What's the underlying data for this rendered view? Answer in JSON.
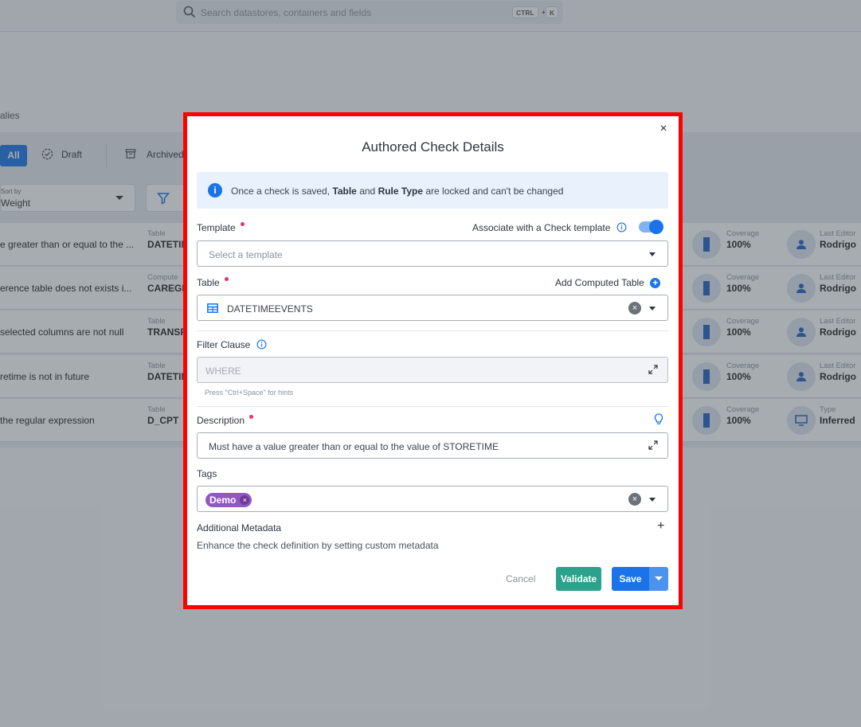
{
  "app": {
    "search_placeholder": "Search datastores, containers and fields",
    "kbd_ctrl": "CTRL",
    "kbd_plus": "+",
    "kbd_k": "K",
    "breadcrumb": "alies",
    "tabs": {
      "all": "All",
      "draft": "Draft",
      "archived": "Archived"
    },
    "sort": {
      "label": "Sort by",
      "value": "Weight"
    },
    "rows": [
      {
        "name": "e greater than or equal to the ...",
        "table_label": "Table",
        "table": "DATETIM",
        "metric_label": "Coverage",
        "metric": "100%",
        "editor_label": "Last Editor",
        "editor": "Rodrigo"
      },
      {
        "name": "erence table does not exists i...",
        "table_label": "Compute",
        "table": "CAREGIV",
        "metric_label": "Coverage",
        "metric": "100%",
        "editor_label": "Last Editor",
        "editor": "Rodrigo"
      },
      {
        "name": "selected columns are not null",
        "table_label": "Table",
        "table": "TRANSF",
        "metric_label": "Coverage",
        "metric": "100%",
        "editor_label": "Last Editor",
        "editor": "Rodrigo"
      },
      {
        "name": "retime is not in future",
        "table_label": "Table",
        "table": "DATETIM",
        "metric_label": "Coverage",
        "metric": "100%",
        "editor_label": "Last Editor",
        "editor": "Rodrigo"
      },
      {
        "name": "the regular expression",
        "table_label": "Table",
        "table": "D_CPT",
        "metric_label": "Coverage",
        "metric": "100%",
        "editor_label": "Type",
        "editor": "Inferred"
      }
    ]
  },
  "modal": {
    "title": "Authored Check Details",
    "info": {
      "prefix": "Once a check is saved, ",
      "b1": "Table",
      "mid": " and ",
      "b2": "Rule Type",
      "suffix": " are locked and can't be changed"
    },
    "template": {
      "label": "Template",
      "associate_label": "Associate with a Check template",
      "associate_on": true,
      "placeholder": "Select a template"
    },
    "table": {
      "label": "Table",
      "add_computed": "Add Computed Table",
      "value": "DATETIMEEVENTS"
    },
    "filter": {
      "label": "Filter Clause",
      "placeholder": "WHERE",
      "hint": "Press \"Ctrl+Space\" for hints"
    },
    "description": {
      "label": "Description",
      "value": "Must have a value greater than or equal to the value of STORETIME"
    },
    "tags": {
      "label": "Tags",
      "items": [
        "Demo"
      ]
    },
    "metadata": {
      "label": "Additional Metadata",
      "desc": "Enhance the check definition by setting custom metadata"
    },
    "buttons": {
      "cancel": "Cancel",
      "validate": "Validate",
      "save": "Save"
    }
  }
}
